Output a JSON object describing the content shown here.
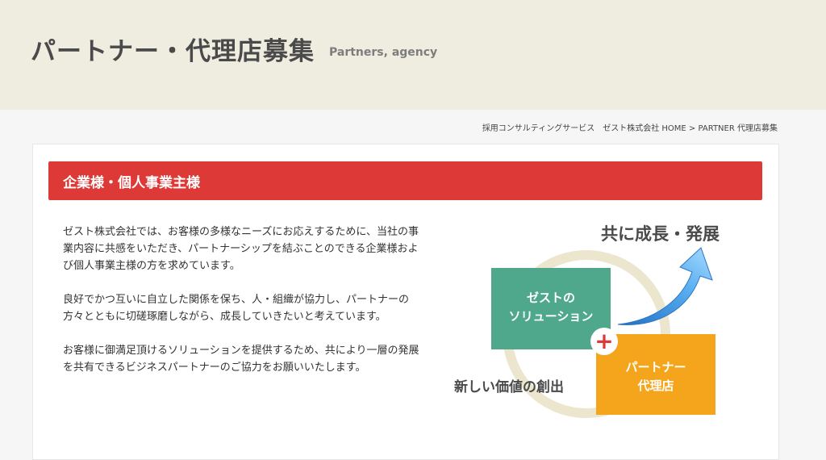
{
  "hero": {
    "title": "パートナー・代理店募集",
    "subtitle": "Partners, agency"
  },
  "breadcrumb": {
    "items": [
      "採用コンサルティングサービス",
      "ゼスト株式会社 HOME",
      "PARTNER 代理店募集"
    ],
    "separator": ">"
  },
  "section": {
    "title": "企業様・個人事業主様"
  },
  "intro": {
    "paragraphs": [
      "ゼスト株式会社では、お客様の多様なニーズにお応えするために、当社の事業内容に共感をいただき、パートナーシップを結ぶことのできる企業様および個人事業主様の方を求めています。",
      "良好でかつ互いに自立した関係を保ち、人・組織が協力し、パートナーの方々とともに切磋琢磨しながら、成長していきたいと考えています。",
      "お客様に御満足頂けるソリューションを提供するため、共により一層の発展を共有できるビジネスパートナーのご協力をお願いいたします。"
    ]
  },
  "diagram": {
    "top_label": "共に成長・発展",
    "solution_line1": "ゼストの",
    "solution_line2": "ソリューション",
    "plus_symbol": "+",
    "partner_line1": "パートナー",
    "partner_line2": "代理店",
    "bottom_label": "新しい価値の創出",
    "colors": {
      "solution_box": "#4fa88b",
      "partner_box": "#f5a51c",
      "ring": "#ece6cf",
      "plus": "#dd3a37",
      "arrow": "#3b8fd8",
      "label_text": "#4a4a4a"
    }
  },
  "colors": {
    "hero_bg": "#efece0",
    "section_bar": "#dd3a37",
    "page_bg": "#f6f6f6"
  }
}
